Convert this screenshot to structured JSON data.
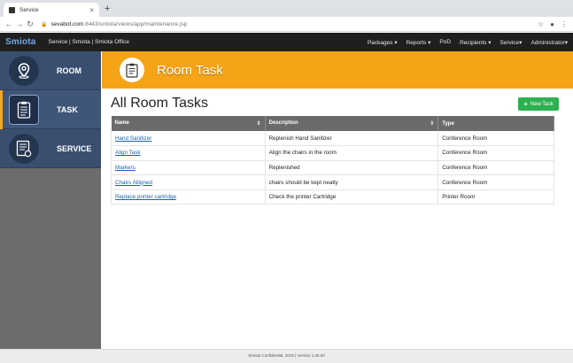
{
  "browser": {
    "tab_title": "Service",
    "tab_close": "×",
    "new_tab": "+",
    "url_host": "sevabot.com",
    "url_path": ":8443/smiota/views/app/maintenance.jsp"
  },
  "navbar": {
    "brand": "Smiota",
    "breadcrumb": "Service | Smiota | Smiota Office",
    "menu": [
      "Packages ▾",
      "Reports ▾",
      "PoD",
      "Recipients ▾",
      "Service▾",
      "Administrator▾"
    ]
  },
  "sidebar": {
    "items": [
      {
        "label": "ROOM",
        "icon": "location-pin-icon"
      },
      {
        "label": "TASK",
        "icon": "checklist-icon"
      },
      {
        "label": "SERVICE",
        "icon": "service-list-icon"
      }
    ],
    "active_index": 1
  },
  "header": {
    "title": "Room Task",
    "icon": "clipboard-checklist-icon",
    "color": "#f5a317"
  },
  "main": {
    "page_title": "All Room Tasks",
    "new_task_label": "New Task",
    "new_task_icon": "+"
  },
  "table": {
    "headers": [
      "Name",
      "Description",
      "Type"
    ],
    "rows": [
      {
        "name": "Hand Sanitizer",
        "description": "Replenish Hand Sanitizer",
        "type": "Conference Room"
      },
      {
        "name": "Align Task",
        "description": "Align the chairs in the room",
        "type": "Conference Room"
      },
      {
        "name": "Markers",
        "description": "Replenished",
        "type": "Conference Room"
      },
      {
        "name": "Chairs Alligned",
        "description": "chairs should be kept neatly",
        "type": "Conference Room"
      },
      {
        "name": "Replace printer cartridge",
        "description": "Check the printer Cartridge",
        "type": "Printer Room"
      }
    ]
  },
  "footer": {
    "text": "Smiota Confidential, 2019 | Version 1.25.00"
  }
}
